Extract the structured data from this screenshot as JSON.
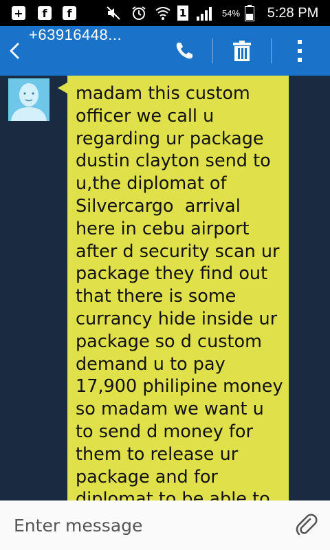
{
  "status_bar": {
    "battery_percent": "54%",
    "sim_slot": "1",
    "time": "5:28 PM"
  },
  "header": {
    "contact": "+63916448..."
  },
  "message": {
    "text": "madam this custom officer we call u regarding ur package dustin clayton send to u,the diplomat of Silvercargo  arrival here in cebu airport after d security scan ur package they find out that there is some currancy hide inside ur package so d custom demand u to pay 17,900 philipine money so madam we want u to send d money for them to release ur package and for diplomat to be able to deliver ur"
  },
  "compose": {
    "placeholder": "Enter message"
  },
  "colors": {
    "action_bar": "#1a73c9",
    "bubble": "#dfe04a",
    "background": "#1a2a40",
    "avatar": "#6ec6e8"
  },
  "icons": [
    "add-notification-icon",
    "facebook-icon",
    "facebook-icon",
    "mute-icon",
    "alarm-icon",
    "wifi-icon",
    "sim-icon",
    "signal-icon",
    "battery-icon",
    "back-icon",
    "call-icon",
    "delete-icon",
    "overflow-menu-icon",
    "attach-icon"
  ]
}
